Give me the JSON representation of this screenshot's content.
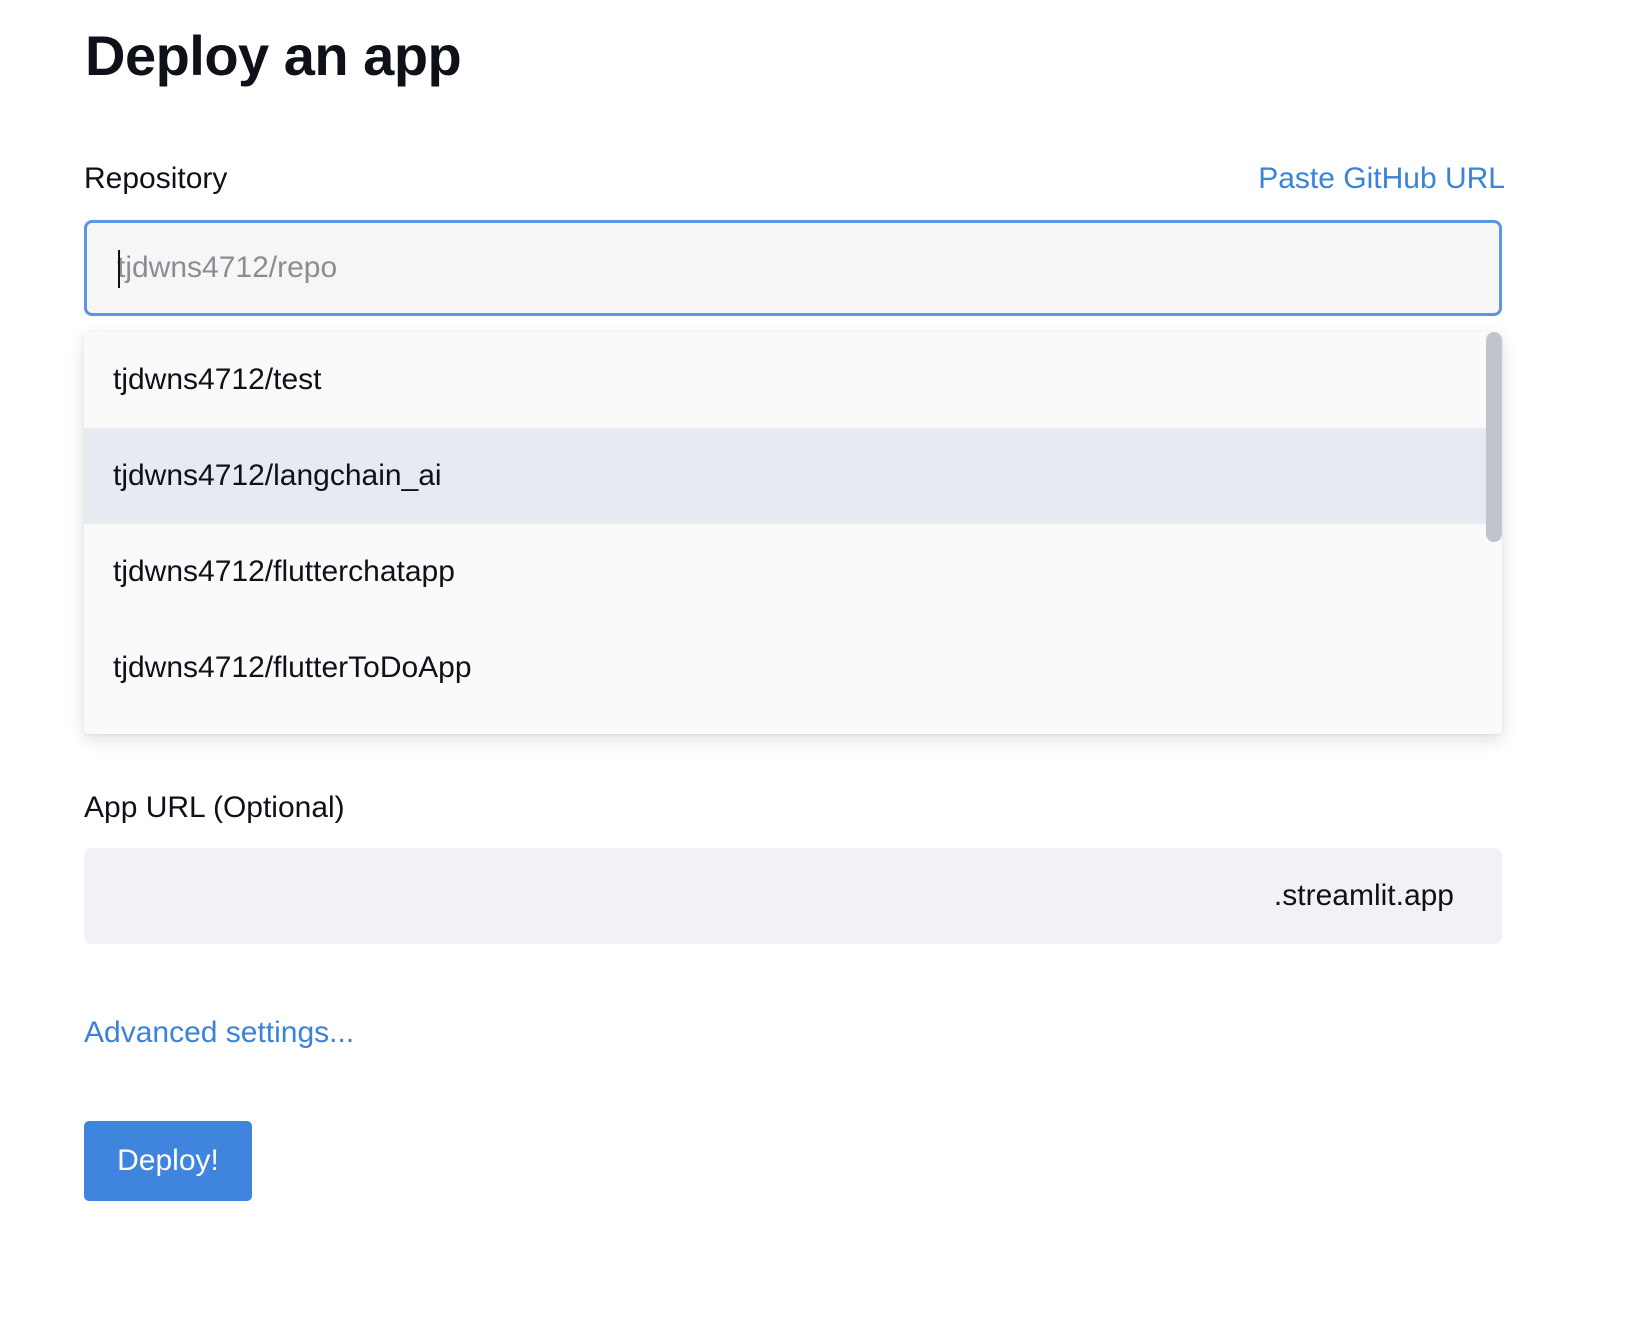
{
  "page": {
    "title": "Deploy an app"
  },
  "repository": {
    "label": "Repository",
    "paste_link": "Paste GitHub URL",
    "value": "",
    "placeholder": "tjdwns4712/repo",
    "options": [
      {
        "label": "tjdwns4712/test",
        "highlighted": false
      },
      {
        "label": "tjdwns4712/langchain_ai",
        "highlighted": true
      },
      {
        "label": "tjdwns4712/flutterchatapp",
        "highlighted": false
      },
      {
        "label": "tjdwns4712/flutterToDoApp",
        "highlighted": false
      }
    ]
  },
  "app_url": {
    "label": "App URL (Optional)",
    "value": "",
    "suffix": ".streamlit.app"
  },
  "advanced": {
    "label": "Advanced settings..."
  },
  "deploy": {
    "label": "Deploy!"
  },
  "colors": {
    "accent": "#3f84dd",
    "link": "#3b82d9",
    "input_focus_border": "#5b95e3",
    "option_highlight": "#e7eaf1"
  }
}
